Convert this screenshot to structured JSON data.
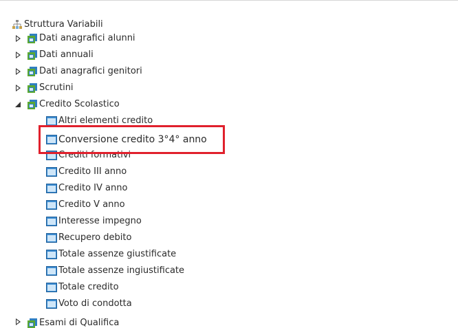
{
  "tree": {
    "root": {
      "label": "Struttura Variabili",
      "icon": "root-tree-icon"
    },
    "groups": [
      {
        "label": "Dati anagrafici alunni",
        "expanded": false,
        "icon": "folder-icon"
      },
      {
        "label": "Dati annuali",
        "expanded": false,
        "icon": "folder-icon"
      },
      {
        "label": "Dati anagrafici genitori",
        "expanded": false,
        "icon": "folder-icon"
      },
      {
        "label": "Scrutini",
        "expanded": false,
        "icon": "folder-icon"
      },
      {
        "label": "Credito Scolastico",
        "expanded": true,
        "icon": "folder-icon",
        "children": [
          {
            "label": "Altri elementi credito",
            "icon": "field-icon"
          },
          {
            "label": "Conversione credito 3°4° anno",
            "icon": "field-icon",
            "highlighted": true
          },
          {
            "label": "Crediti formativi",
            "icon": "field-icon"
          },
          {
            "label": "Credito III anno",
            "icon": "field-icon"
          },
          {
            "label": "Credito IV anno",
            "icon": "field-icon"
          },
          {
            "label": "Credito V anno",
            "icon": "field-icon"
          },
          {
            "label": "Interesse impegno",
            "icon": "field-icon"
          },
          {
            "label": "Recupero debito",
            "icon": "field-icon"
          },
          {
            "label": "Totale assenze giustificate",
            "icon": "field-icon"
          },
          {
            "label": "Totale assenze ingiustificate",
            "icon": "field-icon"
          },
          {
            "label": "Totale credito",
            "icon": "field-icon"
          },
          {
            "label": "Voto di condotta",
            "icon": "field-icon"
          }
        ]
      },
      {
        "label": "Esami di Qualifica",
        "expanded": false,
        "icon": "folder-icon"
      }
    ]
  },
  "colors": {
    "highlight_border": "#e0202c",
    "folder_blue": "#2f7fc1",
    "folder_green": "#5aa832",
    "field_blue": "#3b8bd0"
  }
}
